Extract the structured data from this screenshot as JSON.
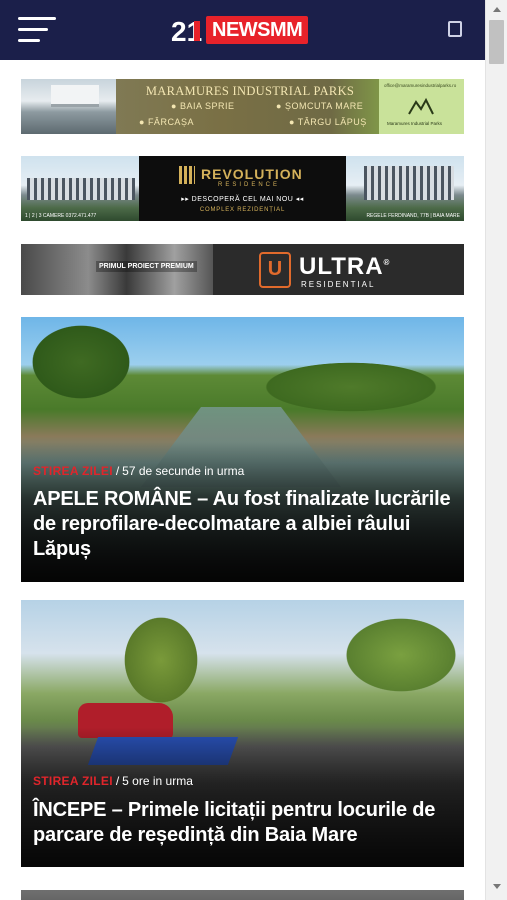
{
  "header": {
    "menu_icon": "hamburger-menu-icon",
    "logo": {
      "number": "21",
      "text": "NEWSMM"
    },
    "search_icon": "search-icon",
    "bg_color": "#1b1f4a",
    "accent_color": "#e8222a"
  },
  "banners": [
    {
      "title": "MARAMURES INDUSTRIAL PARKS",
      "locations": [
        "BAIA SPRIE",
        "ȘOMCUTA MARE",
        "FÂRCAȘA",
        "TÂRGU LĂPUȘ"
      ],
      "side_url": "office@maramuresindustrialparks.ro",
      "side_caption": "Maramures Industrial Parks"
    },
    {
      "brand": "REVOLUTION",
      "brand_sub": "RESIDENCE",
      "tagline": "DESCOPERĂ CEL MAI NOU",
      "tagline2": "COMPLEX REZIDENȚIAL",
      "foot_left": "1 | 2 | 3 CAMERE   0372.471.477",
      "foot_right": "REGELE FERDINAND, 77B | BAIA MARE"
    },
    {
      "photo_text": "PRIMUL PROIECT PREMIUM",
      "brand": "ULTRA",
      "brand_sub": "RESIDENTIAL",
      "logo_letter": "U"
    }
  ],
  "articles": [
    {
      "category": "STIREA ZILEI",
      "time": "57 de secunde in urma",
      "title": "APELE ROMÂNE – Au fost finalizate lucrările de reprofilare-decolmatare a albiei râului Lăpuș"
    },
    {
      "category": "STIREA ZILEI",
      "time": "5 ore in urma",
      "title": "ÎNCEPE – Primele licitații pentru locurile de parcare de reședință din Baia Mare"
    }
  ]
}
